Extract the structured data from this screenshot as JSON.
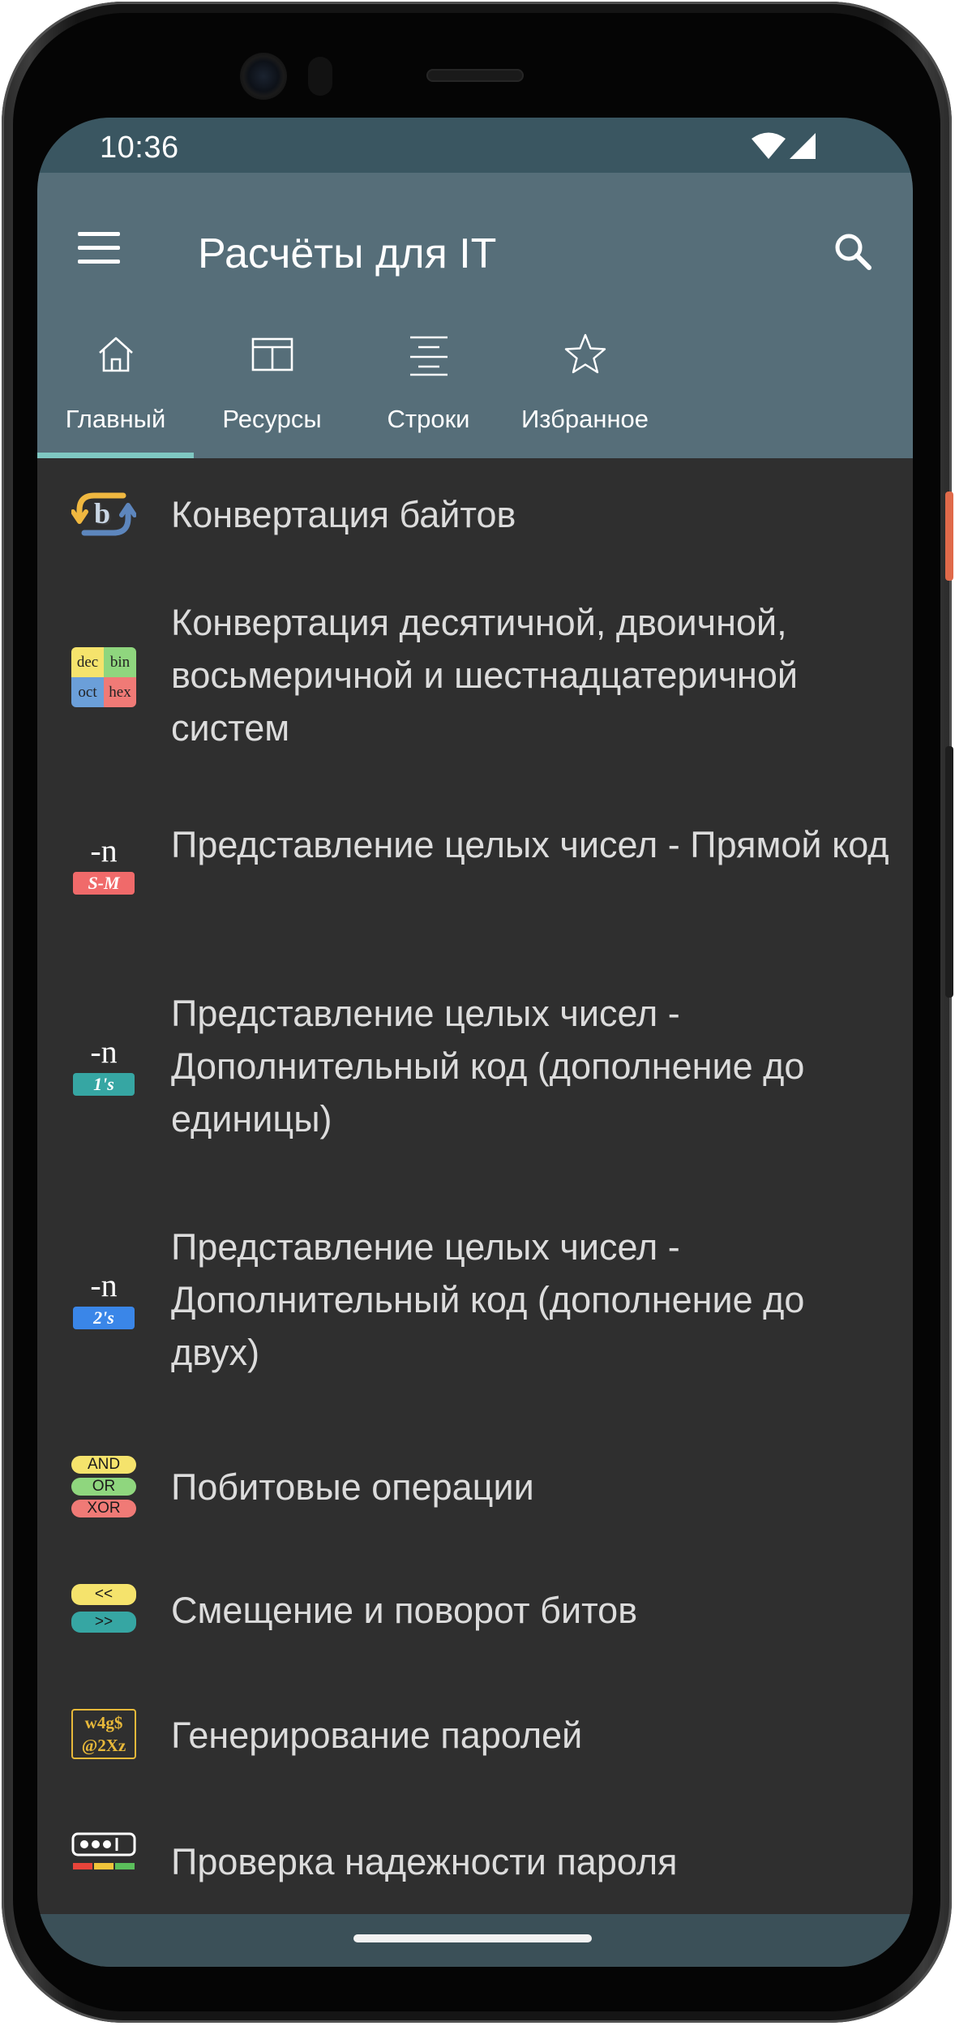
{
  "status_bar": {
    "time": "10:36"
  },
  "app_bar": {
    "title": "Расчёты для IT",
    "menu_icon": "hamburger-menu-icon",
    "search_icon": "search-icon"
  },
  "tabs": [
    {
      "label": "Главный",
      "icon": "home-icon",
      "selected": true
    },
    {
      "label": "Ресурсы",
      "icon": "table-icon",
      "selected": false
    },
    {
      "label": "Строки",
      "icon": "text-align-icon",
      "selected": false
    },
    {
      "label": "Избранное",
      "icon": "star-icon",
      "selected": false
    }
  ],
  "list": {
    "items": [
      {
        "label": "Конвертация байтов",
        "icon": "byte-conversion-icon"
      },
      {
        "label": "Конвертация десятичной, двоичной, восьмеричной и шестнадцатеричной систем",
        "icon": "number-base-icon",
        "icon_text": {
          "dec": "dec",
          "bin": "bin",
          "oct": "oct",
          "hex": "hex"
        }
      },
      {
        "label": "Представление целых чисел - Прямой код",
        "icon": "sign-magnitude-icon",
        "icon_text": {
          "top": "-n",
          "badge": "S-M"
        }
      },
      {
        "label": "Представление целых чисел - Дополнительный код (дополнение до единицы)",
        "icon": "ones-complement-icon",
        "icon_text": {
          "top": "-n",
          "badge": "1's"
        }
      },
      {
        "label": "Представление целых чисел - Дополнительный код (дополнение до двух)",
        "icon": "twos-complement-icon",
        "icon_text": {
          "top": "-n",
          "badge": "2's"
        }
      },
      {
        "label": "Побитовые операции",
        "icon": "bitwise-operations-icon",
        "icon_text": {
          "and": "AND",
          "or": "OR",
          "xor": "XOR"
        }
      },
      {
        "label": "Смещение и поворот битов",
        "icon": "bit-shift-icon",
        "icon_text": {
          "left": "<<",
          "right": ">>"
        }
      },
      {
        "label": "Генерирование паролей",
        "icon": "password-generator-icon",
        "icon_text": {
          "line1": "w4g$",
          "line2": "@2Xz"
        }
      },
      {
        "label": "Проверка надежности пароля",
        "icon": "password-strength-icon"
      }
    ]
  },
  "colors": {
    "status_bar": "#3a5661",
    "app_bar": "#566e79",
    "list_background": "#2f2f2f",
    "tab_indicator": "#7fc8c2",
    "nav_bar": "#3b5058"
  }
}
